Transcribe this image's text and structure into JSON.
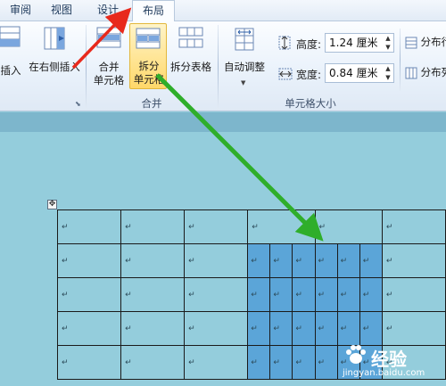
{
  "tabs": [
    "审阅",
    "视图",
    "设计",
    "布局"
  ],
  "ribbon": {
    "insert_below_label": "插入",
    "insert_right_label": "在右侧插入",
    "merge_label": "合并\n单元格",
    "split_label": "拆分\n单元格",
    "split_table_label": "拆分表格",
    "merge_group": "合并",
    "autofit_label": "自动调整",
    "height_label": "高度:",
    "height_value": "1.24 厘米",
    "width_label": "宽度:",
    "width_value": "0.84 厘米",
    "distribute_rows_label": "分布行",
    "distribute_cols_label": "分布列",
    "cellsize_group": "单元格大小"
  },
  "table": {
    "cell_mark": "↵",
    "row_count": 5
  },
  "watermark": {
    "brand": "经验",
    "url": "jingyan.baidu.com"
  },
  "colors": {
    "arrow_red": "#e8291c",
    "arrow_green": "#2fae2a",
    "selection": "#5ba5d8",
    "doc_bg": "#94cddc"
  }
}
